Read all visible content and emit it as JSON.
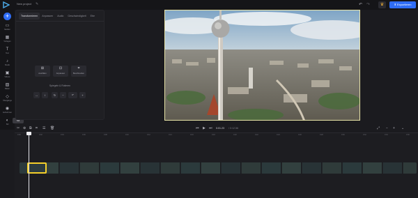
{
  "header": {
    "project_title": "New project",
    "export_label": "Exportieren"
  },
  "sidebar": {
    "items": [
      {
        "label": "Medien",
        "icon": "folder-icon"
      },
      {
        "label": "Vorlagen",
        "icon": "template-icon"
      },
      {
        "label": "Text",
        "icon": "text-icon"
      },
      {
        "label": "Musik",
        "icon": "music-icon"
      },
      {
        "label": "Videos",
        "icon": "video-icon"
      },
      {
        "label": "Bilder",
        "icon": "image-icon"
      },
      {
        "label": "Übergänge",
        "icon": "transition-icon"
      },
      {
        "label": "Aufnehmen",
        "icon": "record-icon"
      },
      {
        "label": "Stil",
        "icon": "style-icon"
      }
    ],
    "tooltip": "Stil"
  },
  "panel": {
    "tabs": [
      "Transformieren",
      "Anpassen",
      "Audio",
      "Geschwindigkeit",
      "Ebe"
    ],
    "tools": [
      {
        "label": "Ausfüllen"
      },
      {
        "label": "Anpassen"
      },
      {
        "label": "Beschneiden"
      }
    ],
    "section_title": "Spiegeln & Rotieren",
    "rotation_value": "0°"
  },
  "player": {
    "timecode": "0:01.23",
    "duration": "/ 0:12.56"
  },
  "timeline": {
    "ruler_labels": [
      "0:00",
      "0:02",
      "0:04",
      "0:06",
      "0:08",
      "0:10",
      "0:12",
      "0:14",
      "0:16",
      "0:18",
      "0:20",
      "0:22",
      "0:24",
      "0:26",
      "0:28",
      "0:30",
      "0:32",
      "0:34",
      "0:36"
    ]
  },
  "colors": {
    "accent": "#2f6df6",
    "selection": "#f4cf2a",
    "premium": "#f2b134"
  }
}
